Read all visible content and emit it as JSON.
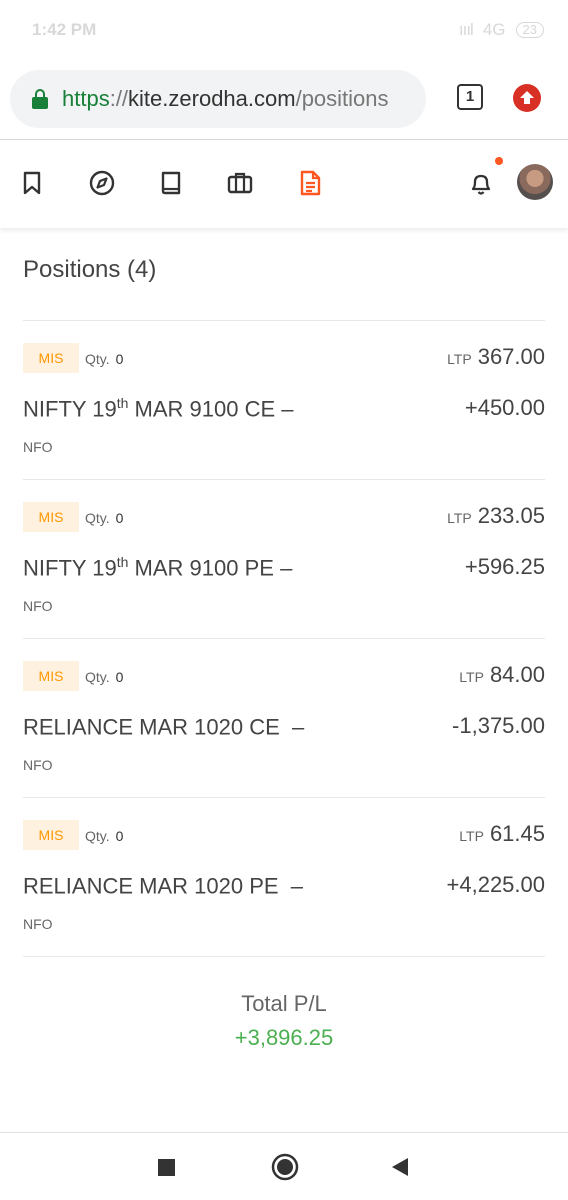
{
  "status_bar": {
    "time": "1:42 PM",
    "signal": "4G",
    "battery": "23"
  },
  "browser": {
    "url_scheme": "https",
    "url_separator": "://",
    "url_host": "kite.zerodha.com",
    "url_path": "/positions",
    "tab_count": "1"
  },
  "nav": {
    "icons": [
      "bookmark-icon",
      "compass-icon",
      "book-icon",
      "briefcase-icon",
      "document-icon",
      "bell-icon"
    ],
    "active_color": "#ff5722"
  },
  "page": {
    "title": "Positions (4)"
  },
  "positions": [
    {
      "product": "MIS",
      "qty_label": "Qty.",
      "qty": "0",
      "ltp_label": "LTP",
      "ltp": "367.00",
      "symbol_prefix": "NIFTY 19",
      "symbol_sup": "th",
      "symbol_suffix": " MAR 9100 CE –",
      "pnl": "+450.00",
      "exchange": "NFO"
    },
    {
      "product": "MIS",
      "qty_label": "Qty.",
      "qty": "0",
      "ltp_label": "LTP",
      "ltp": "233.05",
      "symbol_prefix": "NIFTY 19",
      "symbol_sup": "th",
      "symbol_suffix": " MAR 9100 PE –",
      "pnl": "+596.25",
      "exchange": "NFO"
    },
    {
      "product": "MIS",
      "qty_label": "Qty.",
      "qty": "0",
      "ltp_label": "LTP",
      "ltp": "84.00",
      "symbol_prefix": "RELIANCE MAR 1020 CE  –",
      "symbol_sup": "",
      "symbol_suffix": "",
      "pnl": "-1,375.00",
      "exchange": "NFO"
    },
    {
      "product": "MIS",
      "qty_label": "Qty.",
      "qty": "0",
      "ltp_label": "LTP",
      "ltp": "61.45",
      "symbol_prefix": "RELIANCE MAR 1020 PE  –",
      "symbol_sup": "",
      "symbol_suffix": "",
      "pnl": "+4,225.00",
      "exchange": "NFO"
    }
  ],
  "total": {
    "label": "Total P/L",
    "value": "+3,896.25",
    "color": "#4caf50"
  }
}
